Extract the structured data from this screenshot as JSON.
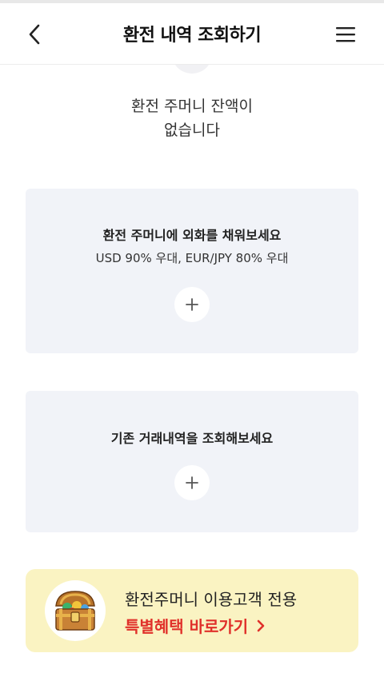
{
  "header": {
    "title": "환전 내역 조회하기",
    "back_icon": "chevron-left-icon",
    "menu_icon": "hamburger-menu-icon"
  },
  "empty_state": {
    "line1": "환전 주머니 잔액이",
    "line2": "없습니다"
  },
  "cards": [
    {
      "title": "환전 주머니에 외화를 채워보세요",
      "subtitle": "USD 90% 우대, EUR/JPY 80% 우대",
      "action_icon": "plus-icon"
    },
    {
      "title": "기존 거래내역을 조회해보세요",
      "action_icon": "plus-icon"
    }
  ],
  "promo": {
    "line1": "환전주머니 이용고객 전용",
    "line2": "특별혜택 바로가기",
    "icon": "treasure-chest-icon",
    "arrow_icon": "chevron-right-icon",
    "accent_color": "#e0302a",
    "background_color": "#faf3c2"
  },
  "colors": {
    "card_background": "#f1f3f8",
    "text": "#222222"
  }
}
